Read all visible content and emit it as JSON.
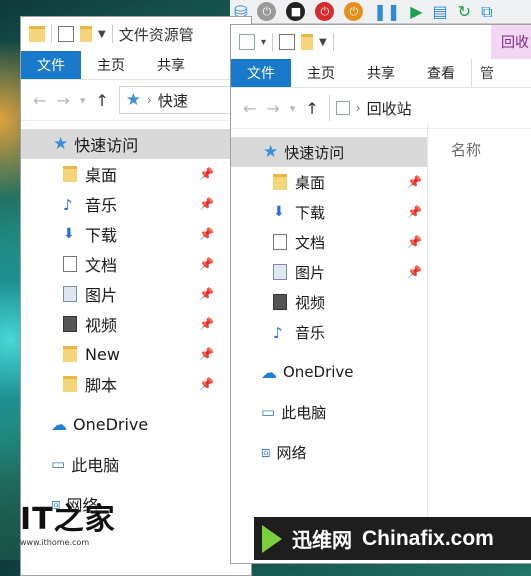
{
  "toolbar": {
    "icons": [
      "network-drive-icon",
      "power-icon",
      "stop-icon",
      "record-icon",
      "power-orange-icon",
      "pause-icon",
      "play-icon",
      "database-icon",
      "refresh-icon",
      "restore-icon"
    ]
  },
  "left_window": {
    "title": "文件资源管",
    "ribbon_tabs": [
      "文件",
      "主页",
      "共享"
    ],
    "address": "快速",
    "nav": [
      {
        "label": "快速访问",
        "icon": "star-icon",
        "selected": true
      },
      {
        "label": "桌面",
        "icon": "folder-icon",
        "pinned": true
      },
      {
        "label": "音乐",
        "icon": "music-icon",
        "pinned": true
      },
      {
        "label": "下载",
        "icon": "download-icon",
        "pinned": true
      },
      {
        "label": "文档",
        "icon": "document-icon",
        "pinned": true
      },
      {
        "label": "图片",
        "icon": "picture-icon",
        "pinned": true
      },
      {
        "label": "视频",
        "icon": "video-icon",
        "pinned": true
      },
      {
        "label": "New",
        "icon": "folder-icon",
        "pinned": true
      },
      {
        "label": "脚本",
        "icon": "folder-icon",
        "pinned": true
      },
      {
        "label": "OneDrive",
        "icon": "cloud-icon"
      },
      {
        "label": "此电脑",
        "icon": "computer-icon"
      },
      {
        "label": "网络",
        "icon": "network-icon"
      }
    ]
  },
  "right_window": {
    "ribbon_tabs": [
      "文件",
      "主页",
      "共享",
      "查看"
    ],
    "context_tab": "回收",
    "context_tab_sub": "管",
    "address": "回收站",
    "column_header": "名称",
    "nav": [
      {
        "label": "快速访问",
        "icon": "star-icon",
        "selected": true
      },
      {
        "label": "桌面",
        "icon": "folder-icon",
        "pinned": true
      },
      {
        "label": "下载",
        "icon": "download-icon",
        "pinned": true
      },
      {
        "label": "文档",
        "icon": "document-icon",
        "pinned": true
      },
      {
        "label": "图片",
        "icon": "picture-icon",
        "pinned": true
      },
      {
        "label": "视频",
        "icon": "video-icon"
      },
      {
        "label": "音乐",
        "icon": "music-icon"
      },
      {
        "label": "OneDrive",
        "icon": "cloud-icon"
      },
      {
        "label": "此电脑",
        "icon": "computer-icon"
      },
      {
        "label": "网络",
        "icon": "network-icon"
      }
    ]
  },
  "watermarks": {
    "ithome_logo": "IT之家",
    "ithome_url": "www.ithome.com",
    "xunwei_cn": "迅维网",
    "xunwei_en": "Chinafix.com"
  }
}
